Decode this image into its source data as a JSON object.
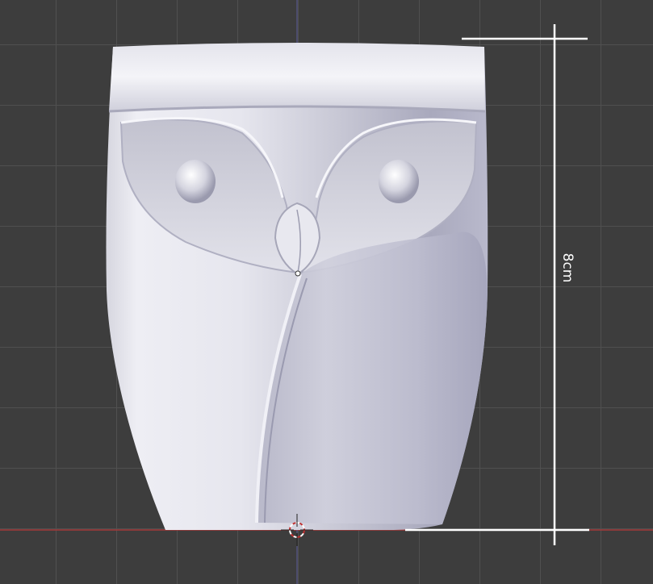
{
  "viewport": {
    "background_color": "#3d3d3d",
    "grid_color": "#505050",
    "x_axis_color": "#a33a3a",
    "y_axis_color": "#5a5a9a"
  },
  "model": {
    "name": "owl cup",
    "surface_color": "#c6c6d2"
  },
  "measurement": {
    "label": "8cm",
    "line_color": "#ffffff"
  },
  "cursor": {
    "icon": "3d-cursor-icon"
  }
}
